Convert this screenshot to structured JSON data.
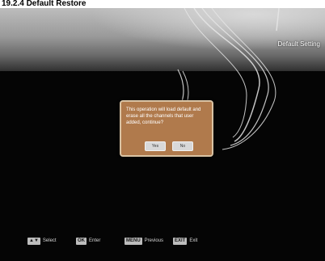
{
  "page_heading": "19.2.4 Default Restore",
  "screen": {
    "title": "Default Setting"
  },
  "dialog": {
    "message": "This operation will load default and erase all the channels that user added, continue?",
    "yes_label": "Yes",
    "no_label": "No"
  },
  "help_bar": {
    "items": [
      {
        "key": "▲▼",
        "label": "Select"
      },
      {
        "key": "OK",
        "label": "Enter"
      },
      {
        "key": "MENU",
        "label": "Previous"
      },
      {
        "key": "EXIT",
        "label": "Exit"
      }
    ]
  },
  "colors": {
    "background": "#050505",
    "banner": "#9a9a9a",
    "dialog": "#b07a4c",
    "dialog_border": "#d9c3a4"
  }
}
